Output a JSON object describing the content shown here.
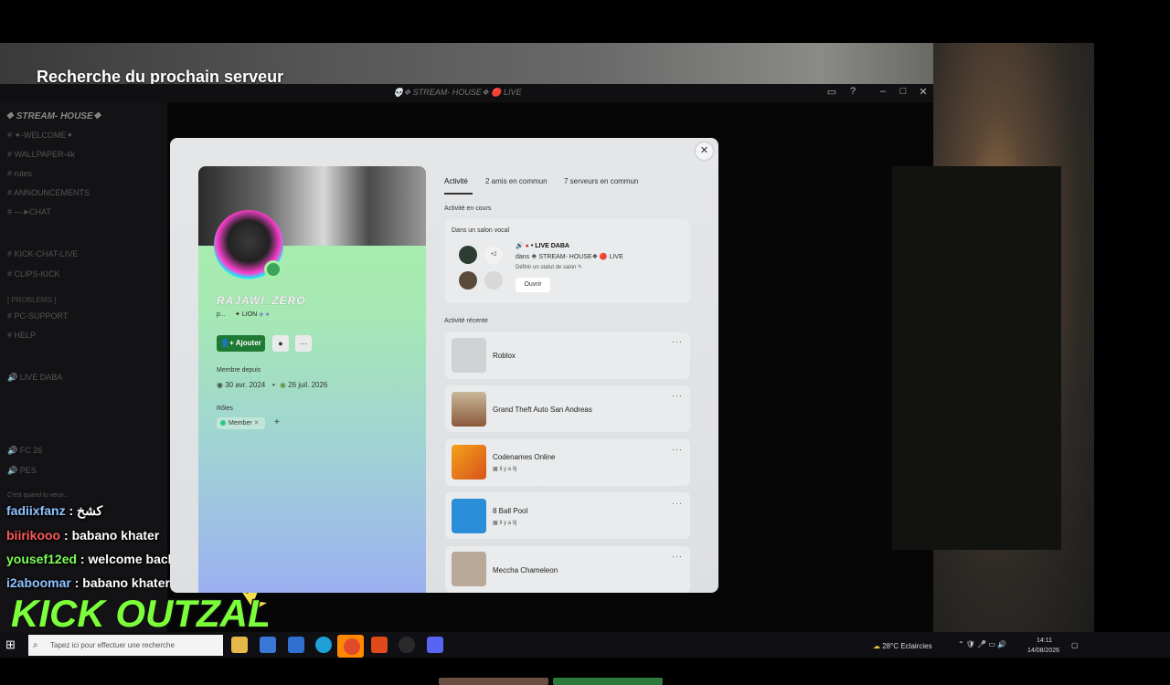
{
  "stream": {
    "title": "Recherche du prochain serveur",
    "chat": [
      {
        "user": "fadiixfanz",
        "message": "كشخ"
      },
      {
        "user": "biirikooo",
        "message": "babano khater"
      },
      {
        "user": "yousef12ed",
        "message": "welcome back king"
      },
      {
        "user": "i2aboomar",
        "message": "babano khater"
      }
    ],
    "logo_text": "KICK OUTZALT"
  },
  "discord": {
    "window_title": "💀❖ STREAM- HOUSE❖ 🔴 LIVE",
    "server_name": "❖ STREAM- HOUSE❖",
    "channels": [
      {
        "label": "✦-WELCOME✦",
        "type": "text"
      },
      {
        "label": "WALLPAPER-4k",
        "type": "text"
      },
      {
        "label": "rules",
        "type": "text"
      },
      {
        "label": "ANNOUNCEMENTS",
        "type": "text"
      },
      {
        "label": "—➤CHAT",
        "type": "text"
      },
      {
        "label": "KICK-CHAT-LIVE",
        "type": "text"
      },
      {
        "label": "CLIPS-KICK",
        "type": "text"
      },
      {
        "label": "PC-SUPPORT",
        "type": "text"
      },
      {
        "label": "HELP",
        "type": "text"
      },
      {
        "label": "LIVE DABA",
        "type": "voice"
      },
      {
        "label": "FC 26",
        "type": "voice"
      },
      {
        "label": "PES",
        "type": "voice"
      }
    ],
    "categories": [
      "PROBLEMS"
    ],
    "status_prompt": "C'est quand tu veux..."
  },
  "profile": {
    "close_icon": "close-icon",
    "username": "RAJAWI_ZERO",
    "subline": "p...",
    "tag": "LION",
    "add_button": "Ajouter",
    "member_since_label": "Membre depuis",
    "discord_date": "30 avr. 2024",
    "server_date": "26 juil. 2026",
    "roles_label": "Rôles",
    "role": "Member",
    "tabs": [
      "Activité",
      "2 amis en commun",
      "7 serveurs en commun"
    ],
    "current_activity_label": "Activité en cours",
    "voice": {
      "heading": "Dans un salon vocal",
      "count": "+2",
      "channel": "LIVE DABA",
      "in_label": "dans",
      "server": "❖ STREAM- HOUSE❖ 🔴 LIVE",
      "status_prompt": "Définir un statut de salon",
      "open_button": "Ouvrir"
    },
    "recent_activity_label": "Activité récente",
    "activities": [
      {
        "title": "Roblox",
        "sub": ""
      },
      {
        "title": "Grand Theft Auto San Andreas",
        "sub": ""
      },
      {
        "title": "Codenames Online",
        "sub": "Il y a 9j"
      },
      {
        "title": "8 Ball Pool",
        "sub": "Il y a 9j"
      },
      {
        "title": "Meccha Chameleon",
        "sub": ""
      }
    ]
  },
  "taskbar": {
    "search_placeholder": "Tapez ici pour effectuer une recherche",
    "weather": "28°C  Eclaircies",
    "time": "14:11",
    "date": "14/08/2026"
  }
}
